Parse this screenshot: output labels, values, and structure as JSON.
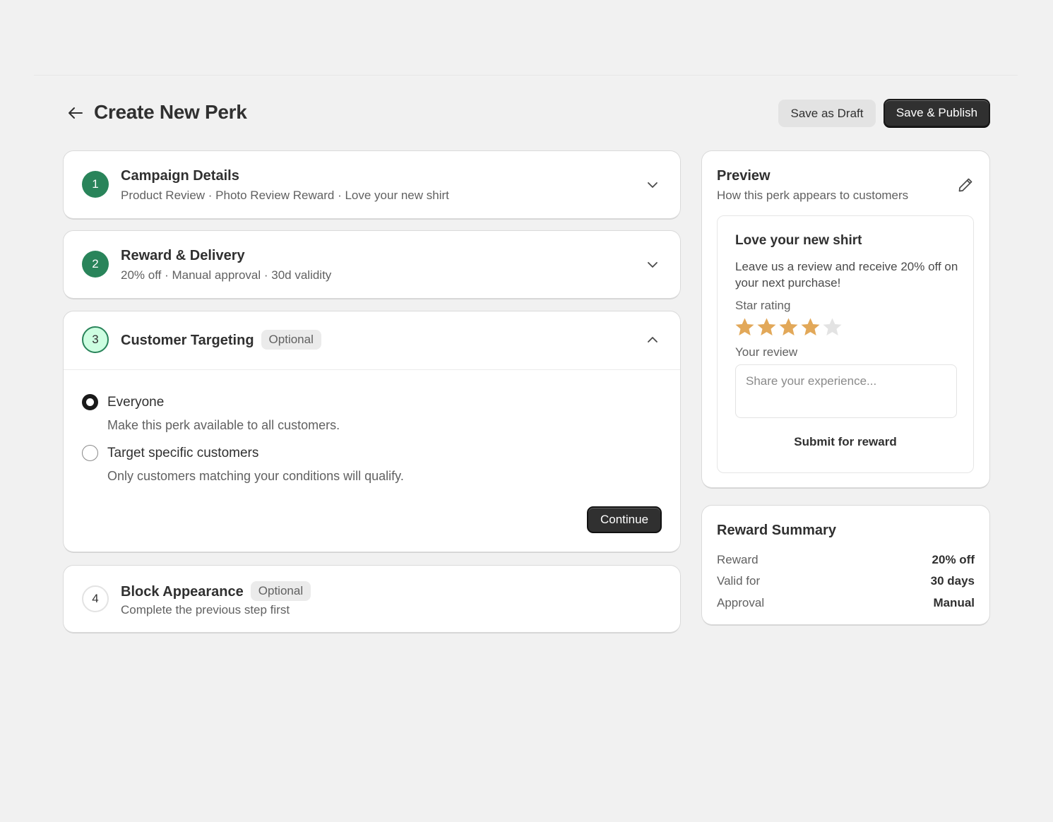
{
  "header": {
    "title": "Create New Perk",
    "save_draft_label": "Save as Draft",
    "save_publish_label": "Save & Publish"
  },
  "steps": [
    {
      "number": "1",
      "title": "Campaign Details",
      "summary": "Product Review · Photo Review Reward · Love your new shirt",
      "status": "completed"
    },
    {
      "number": "2",
      "title": "Reward & Delivery",
      "summary": "20% off · Manual approval · 30d validity",
      "status": "completed"
    },
    {
      "number": "3",
      "title": "Customer Targeting",
      "badge": "Optional",
      "status": "active",
      "options": [
        {
          "label": "Everyone",
          "help": "Make this perk available to all customers.",
          "selected": true
        },
        {
          "label": "Target specific customers",
          "help": "Only customers matching your conditions will qualify.",
          "selected": false
        }
      ],
      "continue_label": "Continue"
    },
    {
      "number": "4",
      "title": "Block Appearance",
      "badge": "Optional",
      "summary": "Complete the previous step first",
      "status": "pending"
    }
  ],
  "preview": {
    "title": "Preview",
    "subtitle": "How this perk appears to customers",
    "card": {
      "title": "Love your new shirt",
      "description": "Leave us a review and receive 20% off on your next purchase!",
      "star_label": "Star rating",
      "rating": 4,
      "max_rating": 5,
      "review_label": "Your review",
      "review_placeholder": "Share your experience...",
      "submit_label": "Submit for reward"
    }
  },
  "summary": {
    "title": "Reward Summary",
    "rows": [
      {
        "key": "Reward",
        "value": "20% off"
      },
      {
        "key": "Valid for",
        "value": "30 days"
      },
      {
        "key": "Approval",
        "value": "Manual"
      }
    ]
  },
  "colors": {
    "background": "#f1f1f1",
    "success_green": "#29845a",
    "active_fill": "#cdfee1",
    "primary_button": "#303030",
    "star_filled": "#e2a859",
    "star_empty": "#e3e3e3"
  },
  "icons": {
    "back": "arrow-left-icon",
    "collapse": "chevron-down-icon",
    "expand": "chevron-up-icon",
    "edit": "pencil-icon",
    "rating": "star-icon"
  }
}
